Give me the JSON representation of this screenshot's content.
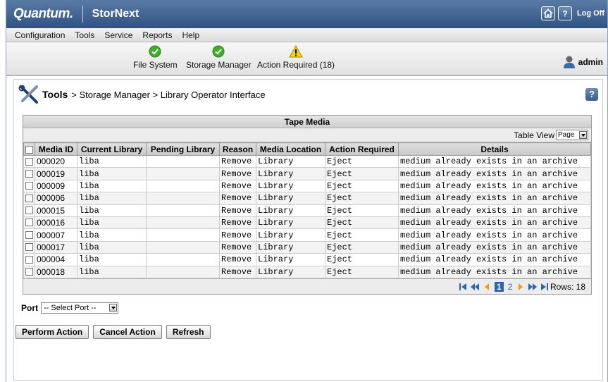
{
  "header": {
    "brand": "Quantum.",
    "product": "StorNext",
    "logoff_label": "Log Off"
  },
  "menu": [
    "Configuration",
    "Tools",
    "Service",
    "Reports",
    "Help"
  ],
  "status": {
    "file_system": "File System",
    "storage_manager": "Storage Manager",
    "action_required": "Action Required (18)",
    "user": "admin"
  },
  "breadcrumb": {
    "section": "Tools",
    "path": "> Storage Manager > Library Operator Interface"
  },
  "grid": {
    "title": "Tape Media",
    "table_view_label": "Table View",
    "table_view_value": "Page",
    "columns": [
      "Media ID",
      "Current Library",
      "Pending Library",
      "Reason",
      "Media Location",
      "Action Required",
      "Details"
    ],
    "rows": [
      [
        "000020",
        "liba",
        "",
        "Remove",
        "Library",
        "Eject",
        "medium already exists in an archive"
      ],
      [
        "000019",
        "liba",
        "",
        "Remove",
        "Library",
        "Eject",
        "medium already exists in an archive"
      ],
      [
        "000009",
        "liba",
        "",
        "Remove",
        "Library",
        "Eject",
        "medium already exists in an archive"
      ],
      [
        "000006",
        "liba",
        "",
        "Remove",
        "Library",
        "Eject",
        "medium already exists in an archive"
      ],
      [
        "000015",
        "liba",
        "",
        "Remove",
        "Library",
        "Eject",
        "medium already exists in an archive"
      ],
      [
        "000016",
        "liba",
        "",
        "Remove",
        "Library",
        "Eject",
        "medium already exists in an archive"
      ],
      [
        "000007",
        "liba",
        "",
        "Remove",
        "Library",
        "Eject",
        "medium already exists in an archive"
      ],
      [
        "000017",
        "liba",
        "",
        "Remove",
        "Library",
        "Eject",
        "medium already exists in an archive"
      ],
      [
        "000004",
        "liba",
        "",
        "Remove",
        "Library",
        "Eject",
        "medium already exists in an archive"
      ],
      [
        "000018",
        "liba",
        "",
        "Remove",
        "Library",
        "Eject",
        "medium already exists in an archive"
      ]
    ],
    "pager": {
      "current_page": "1",
      "next_page": "2",
      "rows_label": "Rows: 18"
    }
  },
  "port": {
    "label": "Port",
    "value": "-- Select Port --"
  },
  "buttons": {
    "perform": "Perform Action",
    "cancel": "Cancel Action",
    "refresh": "Refresh"
  },
  "colors": {
    "header_top": "#5b7ba6",
    "header_bottom": "#2f5384",
    "ok_green": "#3fae2a",
    "warn_yellow": "#f3d21f",
    "pager_orange": "#f39a1e",
    "pager_blue": "#2f64b1"
  }
}
